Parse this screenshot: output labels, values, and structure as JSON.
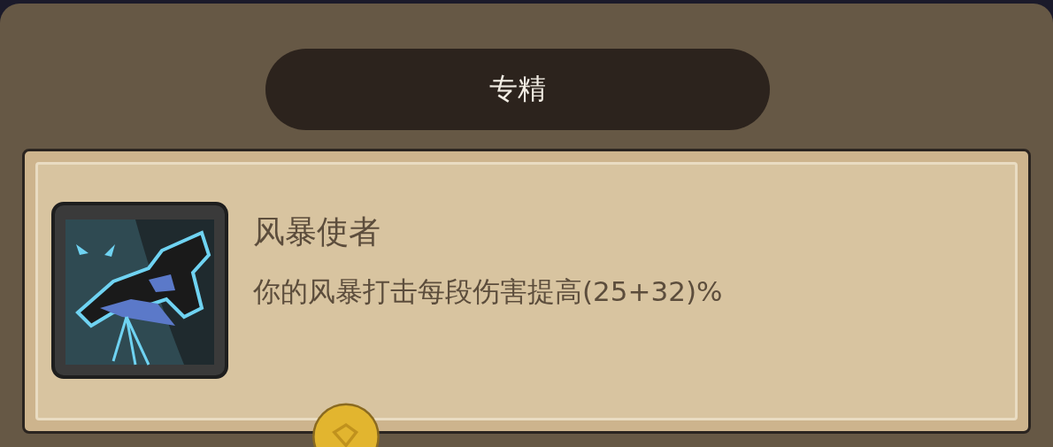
{
  "panel": {
    "title": "专精"
  },
  "specialization": {
    "name": "风暴使者",
    "description": "你的风暴打击每段伤害提高(25+32)%"
  }
}
